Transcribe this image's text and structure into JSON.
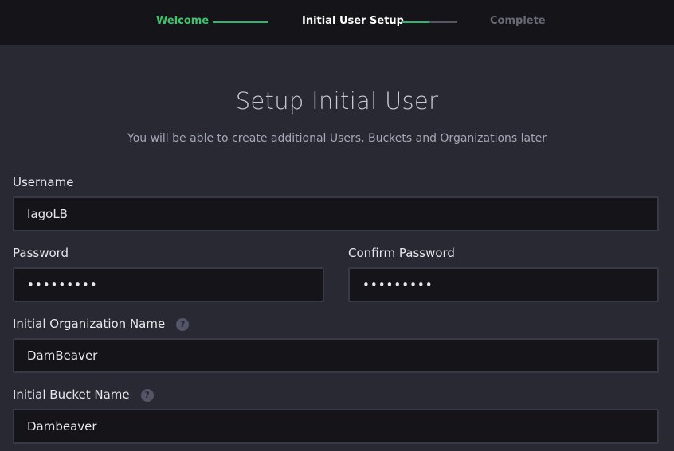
{
  "wizard": {
    "steps": [
      {
        "label": "Welcome",
        "state": "done",
        "progress": 1.0
      },
      {
        "label": "Initial User Setup",
        "state": "active",
        "progress": 0.5
      },
      {
        "label": "Complete",
        "state": "pending"
      }
    ]
  },
  "form": {
    "title": "Setup Initial User",
    "subtitle": "You will be able to create additional Users, Buckets and Organizations later",
    "username": {
      "label": "Username",
      "value": "IagoLB"
    },
    "password": {
      "label": "Password",
      "value": "•••••••••"
    },
    "confirm_password": {
      "label": "Confirm Password",
      "value": "•••••••••"
    },
    "org_name": {
      "label": "Initial Organization Name",
      "value": "DamBeaver",
      "help_icon": "question-circle-icon"
    },
    "bucket_name": {
      "label": "Initial Bucket Name",
      "value": "Dambeaver",
      "help_icon": "question-circle-icon"
    }
  },
  "colors": {
    "background": "#292933",
    "topbar": "#141419",
    "done_step": "#3fc46e",
    "progress": "#2fb56d",
    "input_bg": "#141419",
    "input_border": "#383846"
  }
}
